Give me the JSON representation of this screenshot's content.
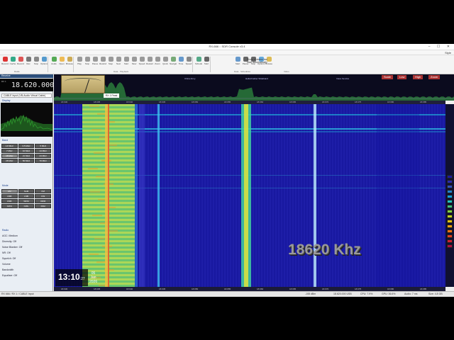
{
  "window": {
    "title": "RX-666 :: SDR Console v3.4",
    "buttons": "–  ☐  ✕"
  },
  "menu": {
    "items": [
      "File",
      "View",
      "Layout",
      "Receive",
      "Rec/Playback",
      "Favourites",
      "Memories",
      "Tools",
      "Help"
    ],
    "active_index": 4,
    "style_label": "Style"
  },
  "ribbon": {
    "buttons": [
      {
        "label": "Record",
        "color": "#d33"
      },
      {
        "label": "Cache",
        "color": "#3a8"
      },
      {
        "label": "Record",
        "color": "#d55"
      },
      {
        "label": "Rec",
        "color": "#777"
      },
      {
        "label": "Stop",
        "color": "#888"
      },
      {
        "label": "Options",
        "color": "#59c"
      },
      {
        "label": "Audio",
        "color": "#5a5"
      },
      {
        "label": "Open",
        "color": "#eb5"
      },
      {
        "label": "Browse",
        "color": "#ca5"
      },
      {
        "label": "Play",
        "color": "#999"
      },
      {
        "label": "Stop",
        "color": "#999"
      },
      {
        "label": "Pause",
        "color": "#999"
      },
      {
        "label": "Rewind",
        "color": "#999"
      },
      {
        "label": "Step",
        "color": "#999"
      },
      {
        "label": "Next",
        "color": "#999"
      },
      {
        "label": "Start",
        "color": "#999"
      },
      {
        "label": "Slow",
        "color": "#999"
      },
      {
        "label": "Speed",
        "color": "#999"
      },
      {
        "label": "Restart",
        "color": "#999"
      },
      {
        "label": "Zoom",
        "color": "#999"
      },
      {
        "label": "Quick",
        "color": "#999"
      },
      {
        "label": "Navigate",
        "color": "#7a7"
      },
      {
        "label": "Time",
        "color": "#69c"
      },
      {
        "label": "Speed",
        "color": "#888"
      },
      {
        "label": "Schedule",
        "color": "#5a8"
      },
      {
        "label": "Start",
        "color": "#666"
      },
      {
        "label": "Start",
        "color": "#69c"
      },
      {
        "label": "Pause",
        "color": "#666"
      },
      {
        "label": "Stop",
        "color": "#666"
      },
      {
        "label": "Options",
        "color": "#6ad"
      },
      {
        "label": "Browse",
        "color": "#db5"
      }
    ],
    "groups": [
      {
        "label": "Radio"
      },
      {
        "label": "Data · Playback"
      },
      {
        "label": "Data · Schedules"
      },
      {
        "label": "Video"
      }
    ],
    "schedule_text": "Show in status bar Start automatically"
  },
  "left_panel": {
    "radio_header": "Receive",
    "freq_tag": "RX 1",
    "frequency": "18.620.000",
    "device": "CABLE Input (VB-Audio Virtual Cable)",
    "display_header": "Display",
    "bands_header": "Band",
    "bands": [
      "1.8 MHz",
      "3.5 MHz",
      "5 MHz",
      "7 MHz",
      "10 MHz",
      "14 MHz",
      "18 MHz",
      "21 MHz",
      "24 MHz",
      "28 MHz",
      "50 MHz",
      "70 MHz"
    ],
    "modes_header": "Mode",
    "modes": [
      "AM",
      "SAM",
      "FM",
      "USB",
      "LSB",
      "CW",
      "DSB",
      "WFM",
      "DRM",
      "CWU",
      "CWL",
      "DIGI"
    ],
    "options": [
      "Radio",
      "AGC: Medium",
      "Diversity: Off",
      "Noise Blanker: Off",
      "NR: Off",
      "Squelch: Off",
      "Volume",
      "Bandwidth",
      "Equaliser: Off"
    ],
    "bandwidths": [
      "5K",
      "6K",
      "7K",
      "8K",
      "9K",
      "10K"
    ],
    "bandwidth_selected": 2
  },
  "spectrum": {
    "buttons": [
      "Scale",
      "Low",
      "High",
      "Zoom"
    ],
    "meter_label": "RX 1 Peak",
    "annotations": [
      "China Army",
      "Hellschreiber Wideband",
      "Voice Service"
    ],
    "scale_left": "-20",
    "scale_ticks": [
      "18.630",
      "18.635",
      "18.640",
      "18.645",
      "18.650",
      "18.655",
      "18.660",
      "18.665",
      "18.670",
      "18.675",
      "18.680",
      "18.685"
    ]
  },
  "waterfall": {
    "overlay_freq": "18620 Khz",
    "time": "13:10",
    "seconds": ":27",
    "date_line1": "05 Jan",
    "date_line2": "2026",
    "scale_ticks": [
      "18.630",
      "18.635",
      "18.640",
      "18.645",
      "18.650",
      "18.655",
      "18.660",
      "18.665",
      "18.670",
      "18.675",
      "18.680",
      "18.685"
    ]
  },
  "colour_scale": [
    "#1a1aa0",
    "#2a2ab0",
    "#3050c0",
    "#2080d0",
    "#10a0e0",
    "#20c0c0",
    "#40c080",
    "#80d040",
    "#c0d020",
    "#e0c010",
    "#f0a010",
    "#f07010",
    "#e04020",
    "#d02030",
    "#b01040"
  ],
  "status": {
    "left": "RX 666 / RX 1 / CABLE Input",
    "items": [
      "-108 dBm",
      "18.620.000 USB",
      "CPU: 7.9%",
      "GPU: 36.6%",
      "Audio: 7 ms",
      "Size: 4.8 GB"
    ]
  }
}
